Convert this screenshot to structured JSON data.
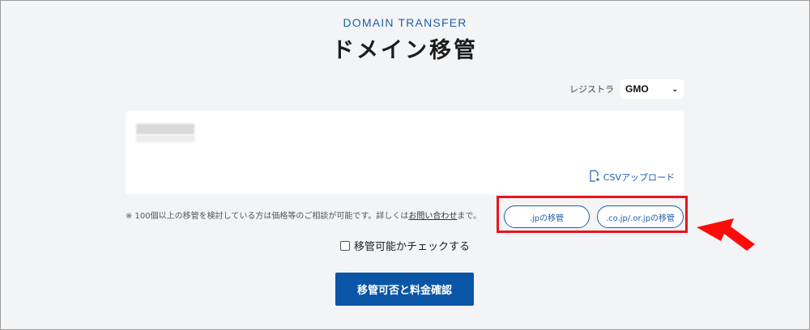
{
  "header": {
    "eyebrow": "DOMAIN TRANSFER",
    "title": "ドメイン移管"
  },
  "registrar": {
    "label": "レジストラ",
    "selected": "GMO"
  },
  "domain_input": {
    "csv_label": "CSVアップロード"
  },
  "note": {
    "text_before": "※ 100個以上の移管を検討している方は価格等のご相談が可能です。詳しくは",
    "link": "お問い合わせ",
    "text_after": "まで。"
  },
  "transfer_buttons": {
    "jp": ".jpの移管",
    "co_jp": ".co.jp/.or.jpの移管"
  },
  "check": {
    "label": "移管可能かチェックする",
    "checked": false
  },
  "submit": {
    "label": "移管可否と料金確認"
  },
  "colors": {
    "accent": "#1d5fae",
    "primary_button": "#0a55a6",
    "annotation": "#e8141c",
    "background": "#f3f4f6"
  }
}
